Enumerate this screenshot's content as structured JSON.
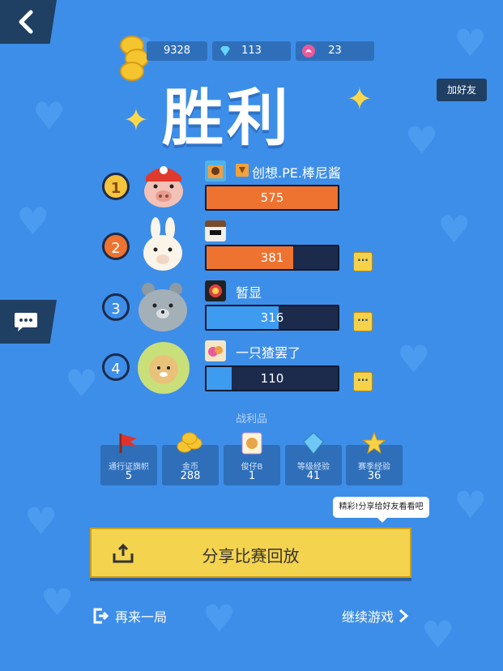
{
  "resources": {
    "coins": "9328",
    "gems": "113",
    "tickets": "23"
  },
  "add_friend_label": "加好友",
  "title": "胜利",
  "players": [
    {
      "rank": "1",
      "name": "创想.PE.棒尼酱",
      "score": "575",
      "score_fraction": 1.0,
      "bar_color": "#ee7330"
    },
    {
      "rank": "2",
      "name": "",
      "score": "381",
      "score_fraction": 0.66,
      "bar_color": "#ee7330"
    },
    {
      "rank": "3",
      "name": "暂显",
      "score": "316",
      "score_fraction": 0.55,
      "bar_color": "#3d9bf0"
    },
    {
      "rank": "4",
      "name": "一只猹罢了",
      "score": "110",
      "score_fraction": 0.19,
      "bar_color": "#3d9bf0"
    }
  ],
  "more_label": "···",
  "loot_title": "战利品",
  "loot": [
    {
      "label": "通行证旗帜",
      "value": "5",
      "icon": "flag-icon"
    },
    {
      "label": "金币",
      "value": "288",
      "icon": "coins-icon"
    },
    {
      "label": "俊仔B",
      "value": "1",
      "icon": "dog-card-icon"
    },
    {
      "label": "等级经验",
      "value": "41",
      "icon": "crystal-icon"
    },
    {
      "label": "赛季经验",
      "value": "36",
      "icon": "star-icon"
    }
  ],
  "tooltip": "精彩!分享给好友看看吧",
  "share_label": "分享比赛回放",
  "play_again_label": "再来一局",
  "continue_label": "继续游戏",
  "colors": {
    "background": "#3d8ee8",
    "dark_panel": "#1f3f63",
    "orange_bar": "#ee7330",
    "blue_bar": "#3d9bf0",
    "yellow_button": "#f4d34f"
  }
}
